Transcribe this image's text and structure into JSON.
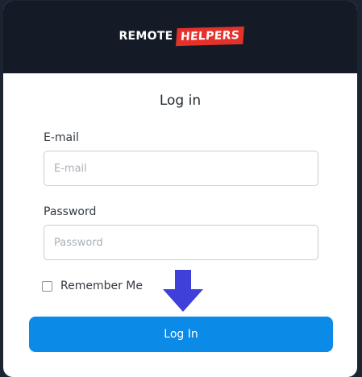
{
  "header": {
    "logo_part1": "REMOTE",
    "logo_part2": "HELPERS"
  },
  "form": {
    "title": "Log in",
    "email_label": "E-mail",
    "email_placeholder": "E-mail",
    "email_value": "",
    "password_label": "Password",
    "password_placeholder": "Password",
    "password_value": "",
    "remember_label": "Remember Me",
    "remember_checked": false,
    "submit_label": "Log In"
  },
  "colors": {
    "background": "#1c2431",
    "header_bg": "#141b26",
    "brand_red": "#e5312b",
    "button": "#0c8ae8",
    "arrow": "#3f3fd9"
  },
  "icons": {
    "overlay": "arrow-down-icon"
  }
}
